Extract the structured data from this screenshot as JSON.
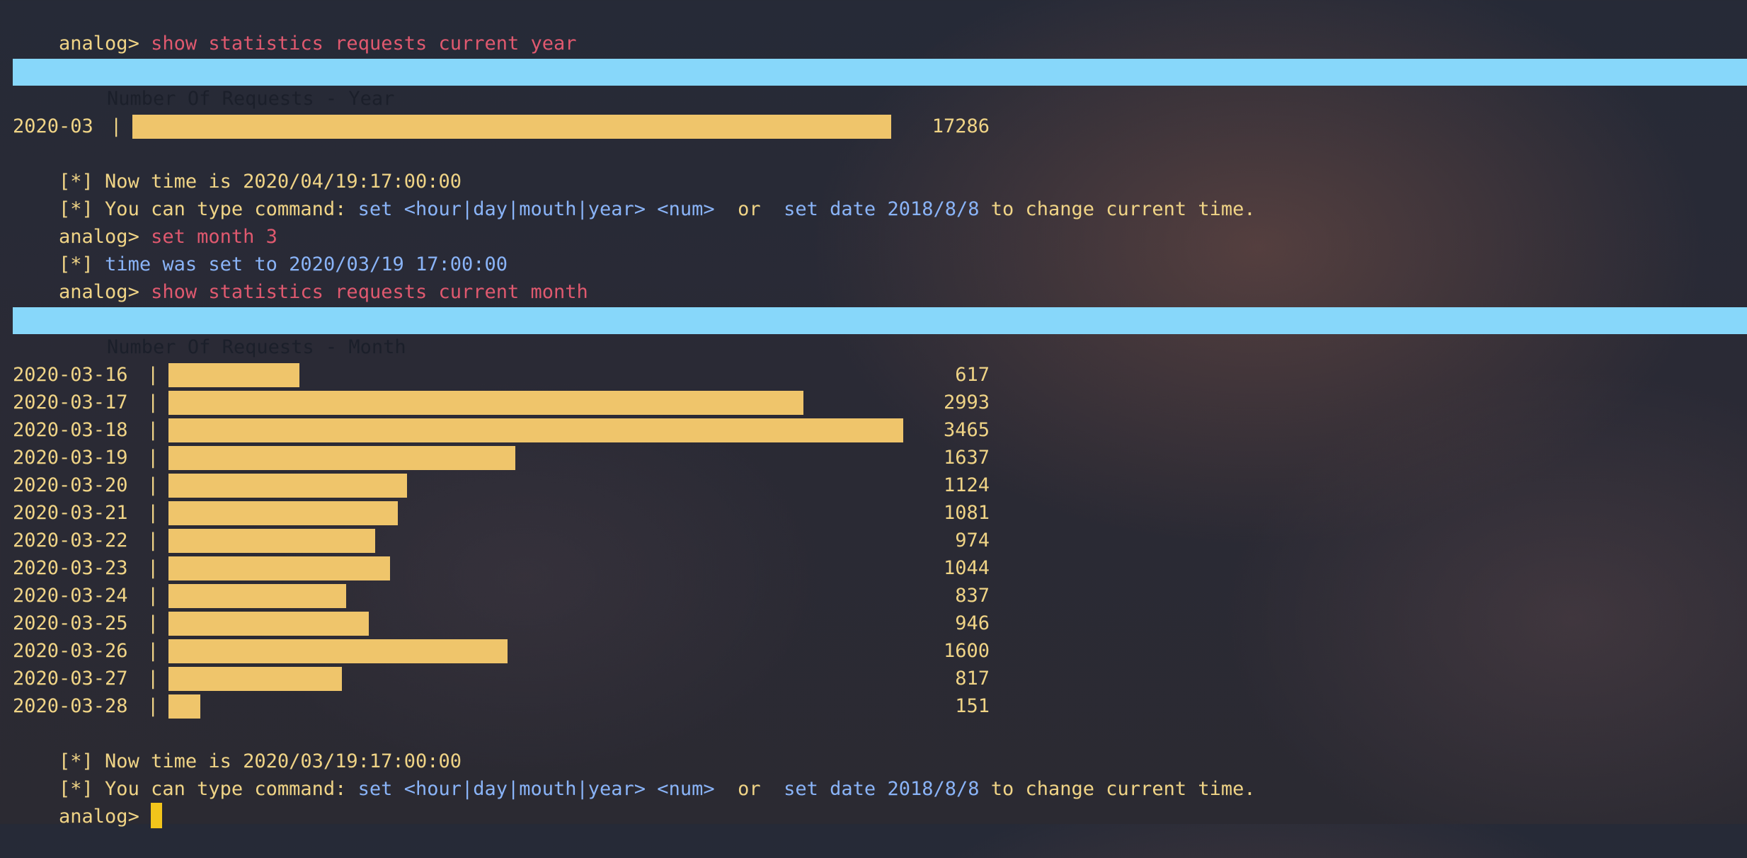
{
  "prompt": "analog>",
  "commands": {
    "first": "show statistics requests current year",
    "second": "set month 3",
    "third": "show statistics requests current month"
  },
  "year_section": {
    "header": "Number Of Requests - Year",
    "rows": [
      {
        "label": "2020-03",
        "value": 17286
      }
    ]
  },
  "info_year": {
    "now_time": "[*] Now time is 2020/04/19:17:00:00",
    "hint_prefix": "[*] You can type command: ",
    "hint_cmd1": "set <hour|day|mouth|year> <num>",
    "hint_or": "  or  ",
    "hint_cmd2": "set date 2018/8/8",
    "hint_suffix": " to change current time."
  },
  "set_result": {
    "prefix": "[*] ",
    "text": "time was set to",
    "value": "2020/03/19 17:00:00"
  },
  "month_section": {
    "header": "Number Of Requests - Month",
    "rows": [
      {
        "label": "2020-03-16",
        "value": 617
      },
      {
        "label": "2020-03-17",
        "value": 2993
      },
      {
        "label": "2020-03-18",
        "value": 3465
      },
      {
        "label": "2020-03-19",
        "value": 1637
      },
      {
        "label": "2020-03-20",
        "value": 1124
      },
      {
        "label": "2020-03-21",
        "value": 1081
      },
      {
        "label": "2020-03-22",
        "value": 974
      },
      {
        "label": "2020-03-23",
        "value": 1044
      },
      {
        "label": "2020-03-24",
        "value": 837
      },
      {
        "label": "2020-03-25",
        "value": 946
      },
      {
        "label": "2020-03-26",
        "value": 1600
      },
      {
        "label": "2020-03-27",
        "value": 817
      },
      {
        "label": "2020-03-28",
        "value": 151
      }
    ]
  },
  "info_month": {
    "now_time": "[*] Now time is 2020/03/19:17:00:00",
    "hint_prefix": "[*] You can type command: ",
    "hint_cmd1": "set <hour|day|mouth|year> <num>",
    "hint_or": "  or  ",
    "hint_cmd2": "set date 2018/8/8",
    "hint_suffix": " to change current time."
  },
  "separator": "|",
  "colors": {
    "prompt": "#f0d486",
    "command": "#e0596f",
    "highlight": "#8ab4f8",
    "header_bg": "#87d7fa",
    "bar": "#efc56b",
    "cursor": "#f2c51b"
  }
}
